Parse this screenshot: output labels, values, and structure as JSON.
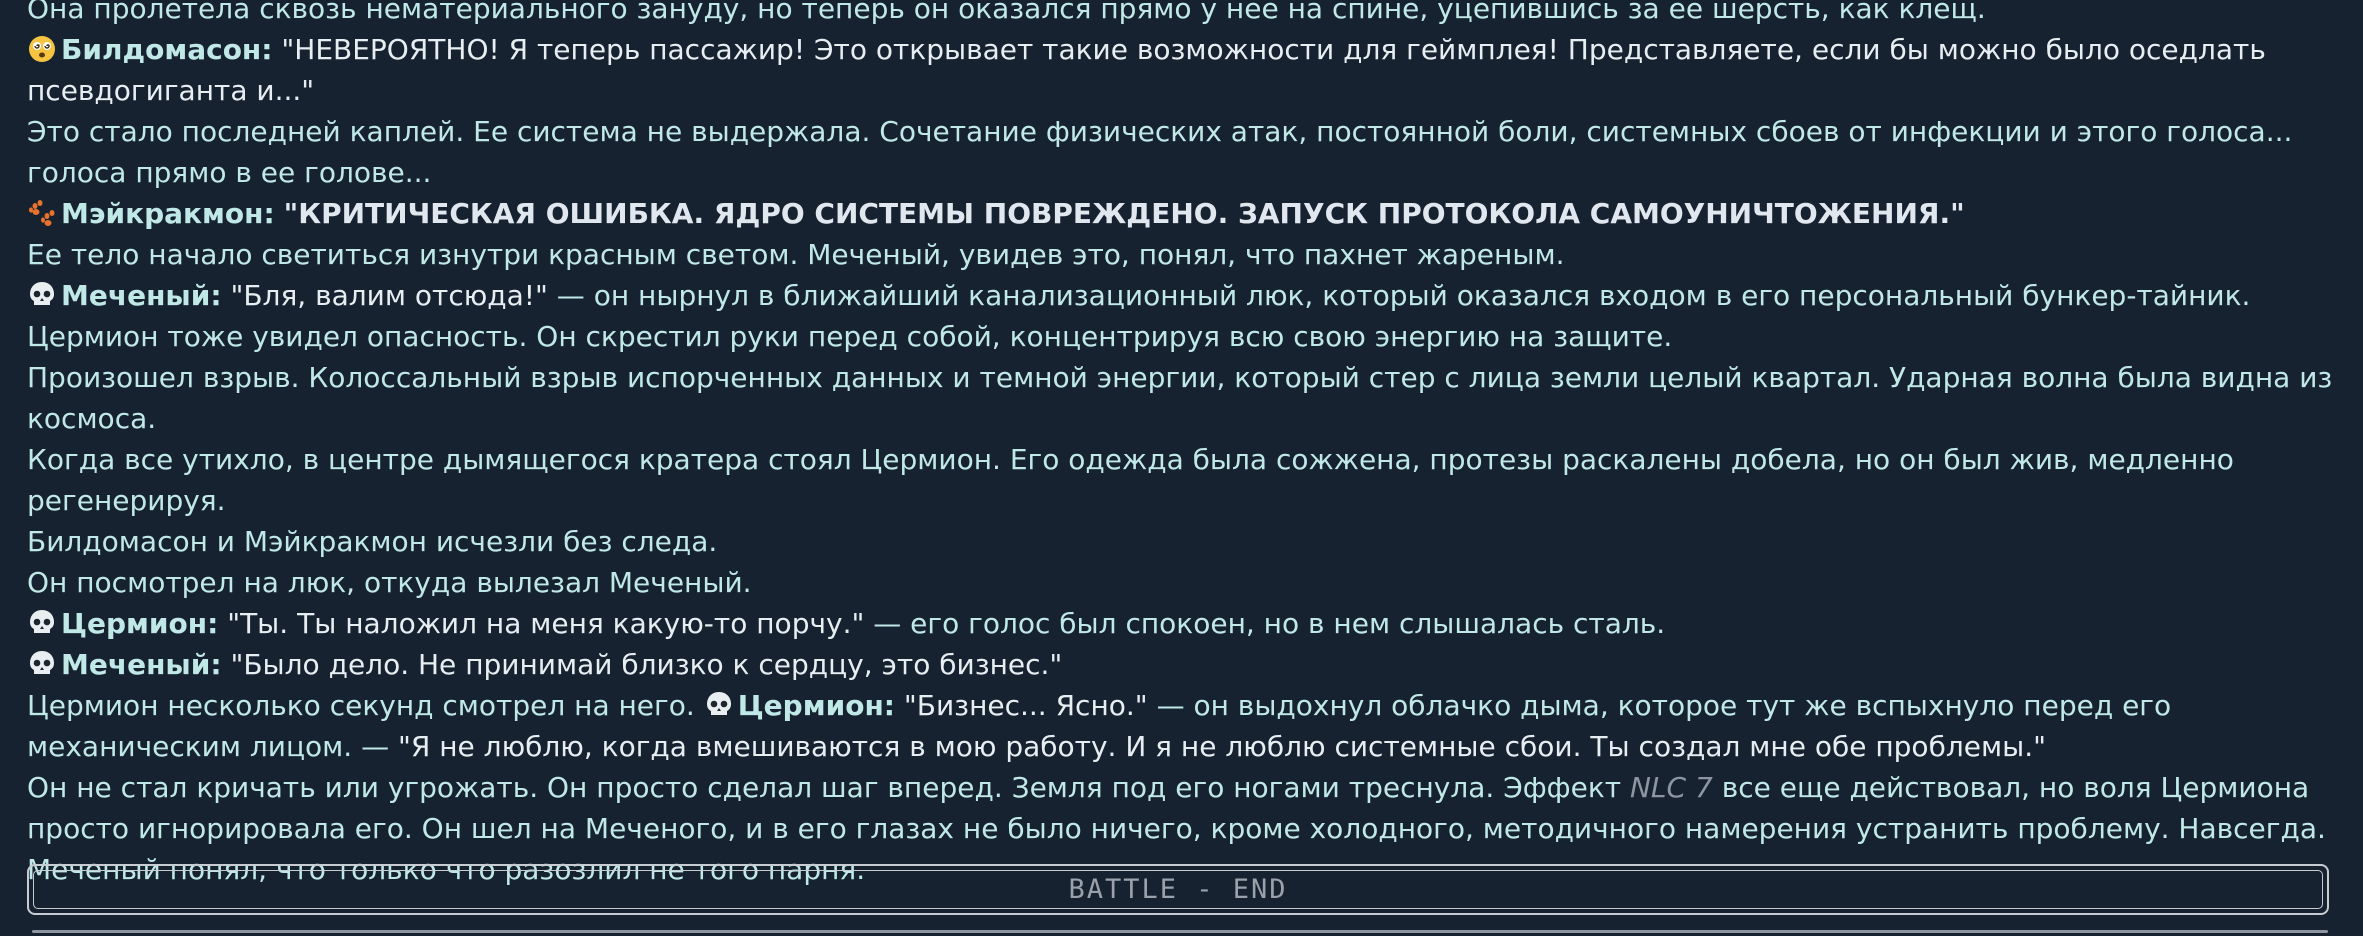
{
  "story": {
    "line_1": "Она пролетела сквозь нематериального зануду, но теперь он оказался прямо у нее на спине, уцепившись за ее шерсть, как клещ.",
    "line_2_speaker": "Билдомасон:",
    "line_2_text": "\"НЕВЕРОЯТНО! Я теперь пассажир! Это открывает такие возможности для геймплея! Представляете, если бы можно было оседлать псевдогиганта и...\"",
    "line_3": "Это стало последней каплей. Ее система не выдержала. Сочетание физических атак, постоянной боли, системных сбоев от инфекции и этого голоса... голоса прямо в ее голове...",
    "line_4_speaker": "Мэйкракмон:",
    "line_4_text": "\"КРИТИЧЕСКАЯ ОШИБКА. ЯДРО СИСТЕМЫ ПОВРЕЖДЕНО. ЗАПУСК ПРОТОКОЛА САМОУНИЧТОЖЕНИЯ.\"",
    "line_5": "Ее тело начало светиться изнутри красным светом. Меченый, увидев это, понял, что пахнет жареным.",
    "line_6_speaker": "Меченый:",
    "line_6_quote": "\"Бля, валим отсюда!\"",
    "line_6_text": " — он нырнул в ближайший канализационный люк, который оказался входом в его персональный бункер-тайник.",
    "line_7": "Цермион тоже увидел опасность. Он скрестил руки перед собой, концентрируя всю свою энергию на защите.",
    "line_8": "Произошел взрыв. Колоссальный взрыв испорченных данных и темной энергии, который стер с лица земли целый квартал. Ударная волна была видна из космоса.",
    "line_9": "Когда все утихло, в центре дымящегося кратера стоял Цермион. Его одежда была сожжена, протезы раскалены добела, но он был жив, медленно регенерируя.",
    "line_10": "Билдомасон и Мэйкракмон исчезли без следа.",
    "line_11": "Он посмотрел на люк, откуда вылезал Меченый.",
    "line_12_speaker": "Цермион:",
    "line_12_quote": "\"Ты. Ты наложил на меня какую-то порчу.\"",
    "line_12_text": " — его голос был спокоен, но в нем слышалась сталь.",
    "line_13_speaker": "Меченый:",
    "line_13_quote": "\"Было дело. Не принимай близко к сердцу, это бизнес.\"",
    "line_14_pre": "Цермион несколько секунд смотрел на него. ",
    "line_14_speaker": "Цермион:",
    "line_14_quote": "\"Бизнес... Ясно.\"",
    "line_14_mid": " — он выдохнул облачко дыма, которое тут же вспыхнуло перед его механическим лицом. — ",
    "line_14_quote2": "\"Я не люблю, когда вмешиваются в мою работу. И я не люблю системные сбои. Ты создал мне обе проблемы.\"",
    "line_15_pre": "Он не стал кричать или угрожать. Он просто сделал шаг вперед. Земля под его ногами треснула. Эффект ",
    "line_15_em": "NLC 7",
    "line_15_post": " все еще действовал, но воля Цермиона просто игнорировала его. Он шел на Меченого, и в его глазах не было ничего, кроме холодного, методичного намерения устранить проблему. Навсегда.",
    "line_16": "Меченый понял, что только что разозлил не того парня."
  },
  "battle_end_label": "BATTLE - END",
  "icons": {
    "bildomason": "dizzy-face-icon",
    "meykrakmon": "paw-prints-icon",
    "skull": "skull-icon"
  },
  "colors": {
    "background": "#172231",
    "text": "#bfe8e6",
    "quote": "#e7eef2",
    "paw": "#e8722c"
  }
}
